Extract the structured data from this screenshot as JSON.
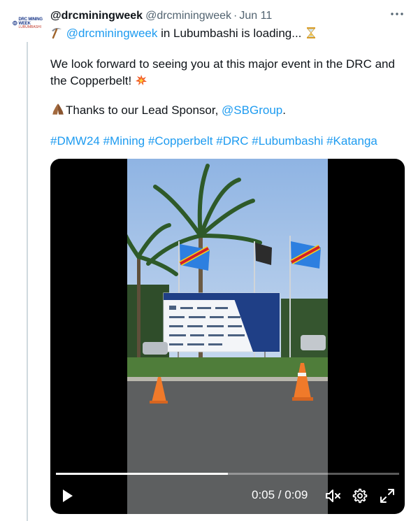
{
  "author": {
    "display_name": "@drcminingweek",
    "handle": "@drcminingweek",
    "separator": "·",
    "date": "Jun 11",
    "avatar_text": "DRC MINING WEEK",
    "avatar_sub": "LUBUMBASHI"
  },
  "tweet": {
    "line1_mention": "@drcminingweek",
    "line1_rest": " in Lubumbashi is loading...",
    "line2": "We look forward to seeing you at this major event in the DRC and the Copperbelt!",
    "line3_prefix": "Thanks to our Lead Sponsor, ",
    "line3_mention": "@SBGroup",
    "line3_suffix": ".",
    "hashtags": [
      "#DMW24",
      "#Mining",
      "#Copperbelt",
      "#DRC",
      "#Lubumbashi",
      "#Katanga"
    ]
  },
  "video": {
    "progress": 0.5,
    "time_display": "0:05 / 0:09"
  },
  "icons": {
    "more": "more-options-icon",
    "play": "play-icon",
    "mute": "mute-icon",
    "settings": "settings-icon",
    "fullscreen": "fullscreen-icon"
  }
}
